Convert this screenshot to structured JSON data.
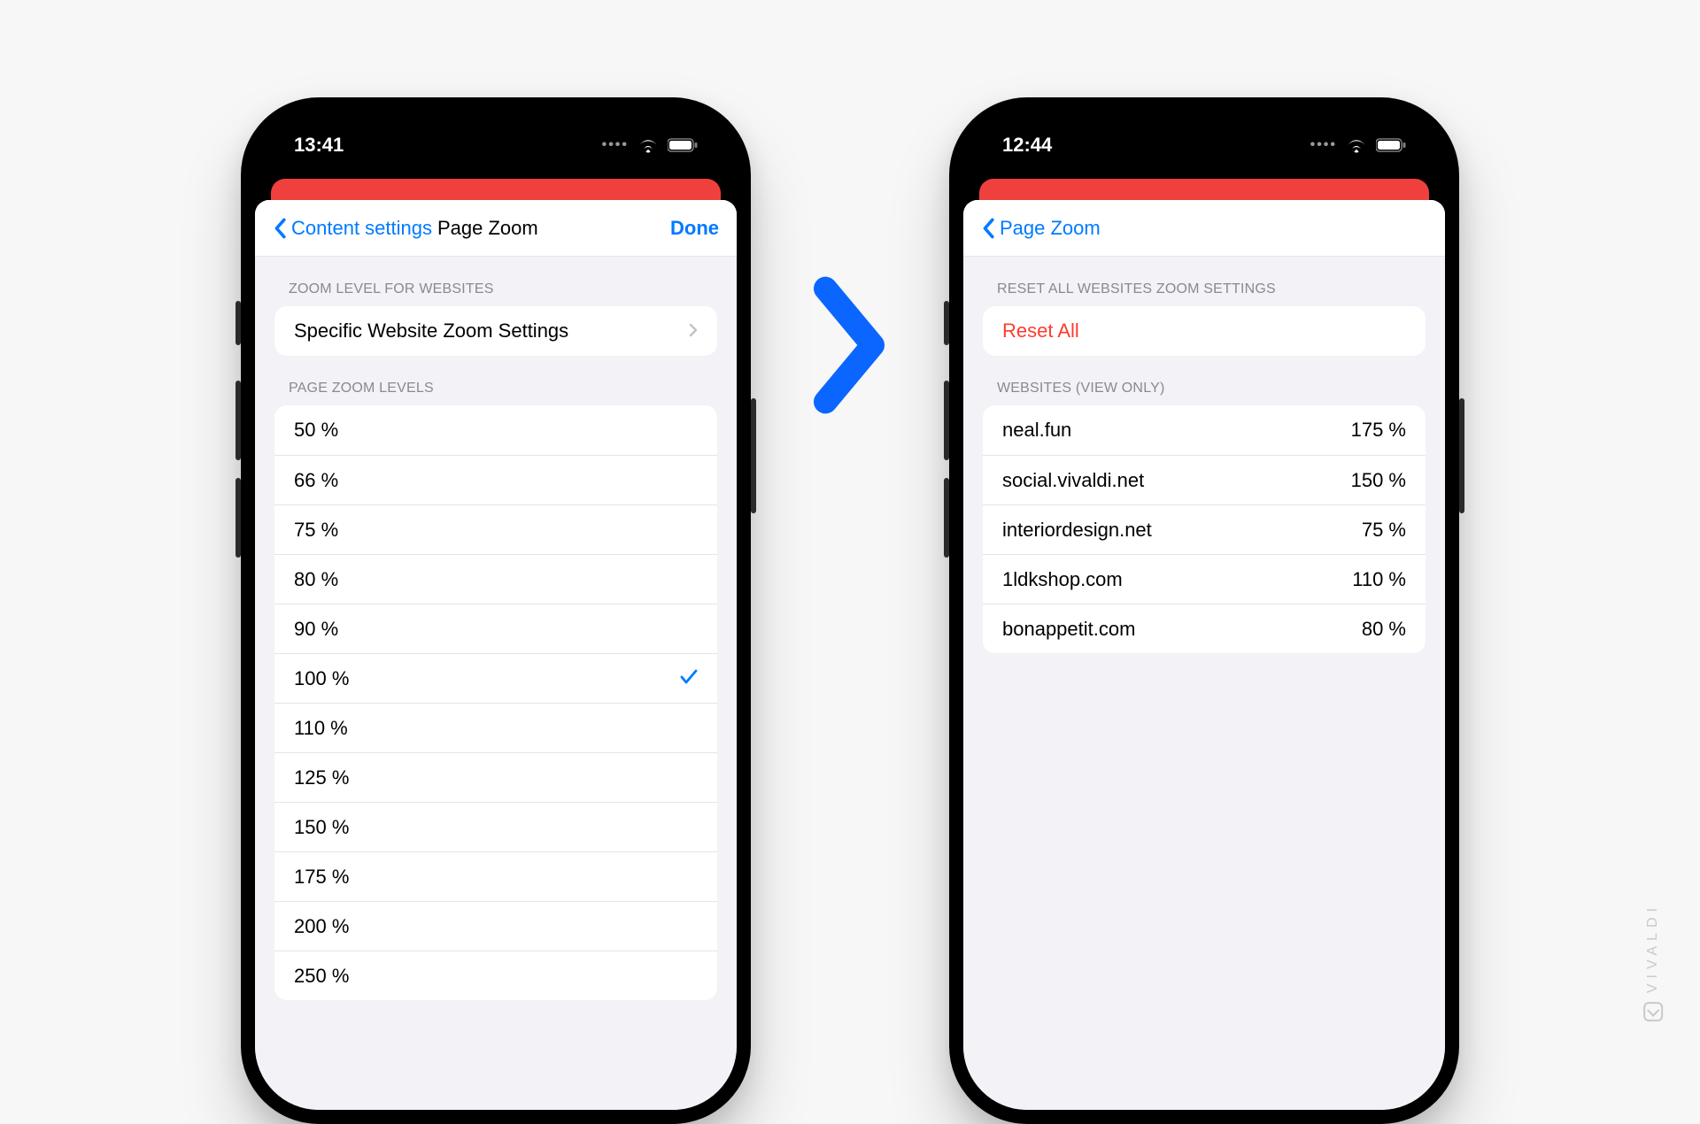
{
  "watermark": "VIVALDI",
  "left": {
    "status": {
      "time": "13:41"
    },
    "nav": {
      "back": "Content settings",
      "title": "Page Zoom",
      "done": "Done"
    },
    "section1_header": "ZOOM LEVEL FOR WEBSITES",
    "specific_row": "Specific Website Zoom Settings",
    "section2_header": "PAGE ZOOM LEVELS",
    "zoom_levels": [
      "50 %",
      "66 %",
      "75 %",
      "80 %",
      "90 %",
      "100 %",
      "110 %",
      "125 %",
      "150 %",
      "175 %",
      "200 %",
      "250 %"
    ],
    "selected_index": 5
  },
  "right": {
    "status": {
      "time": "12:44"
    },
    "nav": {
      "back": "Page Zoom"
    },
    "section1_header": "RESET ALL WEBSITES ZOOM SETTINGS",
    "reset_label": "Reset All",
    "section2_header": "WEBSITES (VIEW ONLY)",
    "sites": [
      {
        "host": "neal.fun",
        "zoom": "175 %"
      },
      {
        "host": "social.vivaldi.net",
        "zoom": "150 %"
      },
      {
        "host": "interiordesign.net",
        "zoom": "75 %"
      },
      {
        "host": "1ldkshop.com",
        "zoom": "110 %"
      },
      {
        "host": "bonappetit.com",
        "zoom": "80 %"
      }
    ]
  }
}
